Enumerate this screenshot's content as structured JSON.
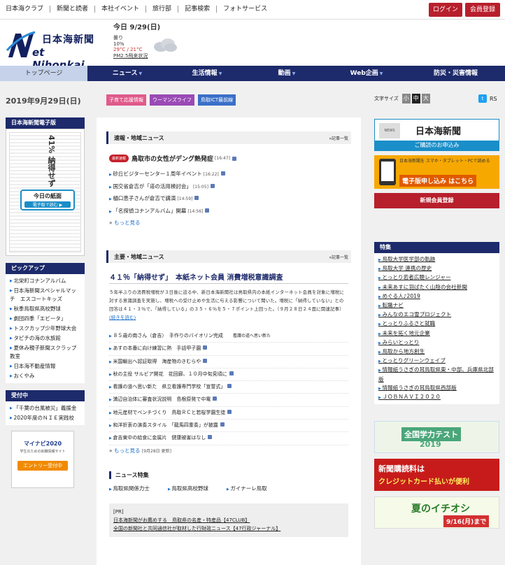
{
  "topnav": {
    "links": [
      "日本海クラブ",
      "新聞と読者",
      "本社イベント",
      "旅行部",
      "記事検索",
      "フォトサービス"
    ],
    "login": "ログイン",
    "member": "会員登録"
  },
  "logo": {
    "jp": "日本海新聞",
    "en": "et Nihonkai"
  },
  "weather": {
    "date": "今日 9/29(日)",
    "condition": "曇り",
    "rain": "10%",
    "temp": "29°C / 21°C",
    "pm": "PM2.5飛来状況"
  },
  "mainnav": [
    {
      "label": "トップページ",
      "active": true
    },
    {
      "label": "ニュース"
    },
    {
      "label": "生活情報"
    },
    {
      "label": "動画"
    },
    {
      "label": "Web企画"
    },
    {
      "label": "防災・災害情報"
    }
  ],
  "today_date": "2019年9月29日(日)",
  "tags": [
    {
      "label": "子育て応援情報",
      "color": "#e05a8a"
    },
    {
      "label": "ウーマンズライフ",
      "color": "#9a4ab5"
    },
    {
      "label": "鳥取ICT最前線",
      "color": "#3a6fc8"
    }
  ],
  "fontsize": {
    "label": "文字サイズ",
    "small": "小",
    "medium": "中",
    "large": "大"
  },
  "social": {
    "rss": "RS"
  },
  "left": {
    "epaper_title": "日本海新聞電子版",
    "epaper_headline": "41% 納得せず",
    "epaper_today": "今日の紙面",
    "epaper_read": "電子版で読む ▶",
    "pickup_title": "ピックアップ",
    "pickup": [
      "北栄町コナンアルバム",
      "日本海新聞スペシャルマッチ　エスコートキッズ",
      "秋季鳥取県高校野球",
      "劇団四季「エビータ」",
      "トスクカップ少年野球大会",
      "タピチの海の水族館",
      "夏休み親子新聞スクラップ教室",
      "日本海不動産情報",
      "おくやみ"
    ],
    "accept_title": "受付中",
    "accept": [
      "「千葉の台風被災」義援金",
      "2020年度のＮＩＥ実践校"
    ],
    "mynavi": {
      "logo": "マイナビ2020",
      "sub": "学生のための就職情報サイト",
      "cta": "エントリー受付中"
    }
  },
  "center": {
    "flash": {
      "title": "速報・地域ニュース",
      "more": "»記事一覧",
      "badge": "最新速報",
      "lead": "鳥取市の女性がデング熱発症",
      "lead_time": "[16:47]",
      "items": [
        {
          "text": "砂丘ビジターセンター１周年イベント",
          "time": "[16:22]"
        },
        {
          "text": "国交省倉吉が「道の活用検討会」",
          "time": "[15:05]"
        },
        {
          "text": "樋口恵子さんが倉吉で講演",
          "time": "[14:59]"
        },
        {
          "text": "「名探偵コナンアルバム」開幕",
          "time": "[14:56]"
        }
      ],
      "see_more": "もっと見る"
    },
    "main": {
      "title": "主要・地域ニュース",
      "more": "»記事一覧",
      "feature_title": "４１％「納得せず」　本紙ネット会員 消費増税意識調査",
      "feature_body": "５年半ぶりの消費税増税が３日後に迫る中、新日本海新聞社は鳥取県内の本紙インターネット会員を対象に増税に対する意識調査を実施し、増税への受け止めや生活に与える影響について聞いた。増税に「納得していない」との回答は４１・３％で、「納得している」の３５・６％を５・７ポイント上回った。（９月２８日２４面に関連記事）",
      "continue": "続きを読む",
      "items": [
        {
          "text": "８５歳の南さん（倉吉）　手作りのバイオリン完成",
          "sub": "看護の道へ思い新た"
        },
        {
          "text": "あすの本番に向け練習に熱　手話甲子園"
        },
        {
          "text": "米国輸出へ認証取得　海産物のきむらや"
        },
        {
          "text": "秋の主役 サルビア開花　花回廊、１０月中旬見頃に"
        },
        {
          "text": "看護の道へ思い新た　県立看護専門学校「宣誓式」"
        },
        {
          "text": "満辺自治体に審査状況説明　島根原発で中電"
        },
        {
          "text": "地元産材でベンチづくり　鳥取ＲＣと若桜学園生徒"
        },
        {
          "text": "和洋折衷の演奏スタイル　「龍馬四重奏」が披露"
        },
        {
          "text": "倉吉東中の給食に金属片　健康被害はなし"
        }
      ],
      "see_more": "もっと見る",
      "see_more_date": "[9月28日 更新]"
    },
    "special": {
      "title": "ニュース特集",
      "items": [
        "鳥取県関係力士",
        "鳥取県高校野球",
        "ガイナーレ鳥取"
      ]
    },
    "pr": {
      "label": "[PR]",
      "line1": "日本海新聞がお薦めする　鳥取県の名産・特産品【47CLUB】",
      "line2": "全国の新聞社と共同通信社が取材した行財政ニュース【47行政ジャーナル】"
    }
  },
  "right": {
    "ad1": {
      "name": "日本海新聞",
      "band": "ご購読のお申込み",
      "icon": "NEWS"
    },
    "ad2": {
      "text": "日本海新聞を スマホ・タブレット・PCで読める",
      "cta": "電子版申し込み はこちら"
    },
    "register": "新規会員登録",
    "special_title": "特集",
    "special": [
      "鳥取大学医学部の軌跡",
      "鳥取大学 連携の歴史",
      "とっとり若者広聴レンジャー",
      "未来あすに羽ばたく山陰の会社新聞",
      "めぐる人♪2019",
      "転職ナビ",
      "みんなのエコ雪プロジェクト",
      "とっとりふるさと就職",
      "未来を拓く地元企業",
      "みらいとっとり",
      "鳥取から地方創生",
      "とっとりグリーンウェイブ",
      "情報紙うさぎの耳鳥取県東・中部、兵庫県北部版",
      "情報紙うさぎの耳鳥取県西部版",
      "ＪＯＢＮＡＶＩ２０２０"
    ],
    "banner1": {
      "text": "全国学力テスト",
      "year": "2019"
    },
    "banner2": {
      "text": "新聞購読料は",
      "sub": "クレジットカード払いが便利"
    },
    "banner3": {
      "text": "夏のイチオシ",
      "date": "9/16(月)まで"
    }
  }
}
